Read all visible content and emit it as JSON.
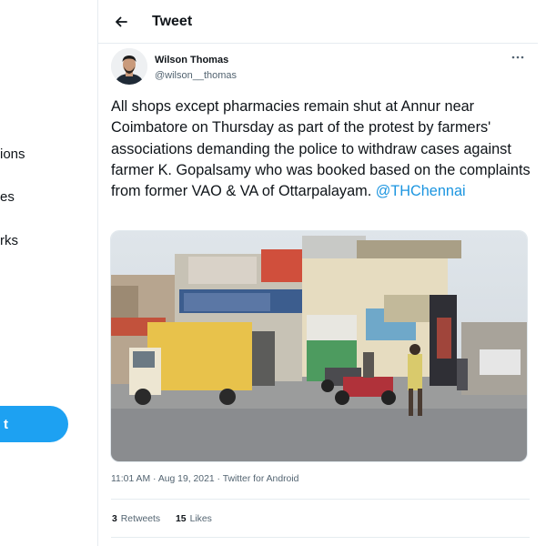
{
  "nav": {
    "items": [
      {
        "label": "ions"
      },
      {
        "label": "es"
      },
      {
        "label": "rks"
      }
    ],
    "tweet_button_label": "t"
  },
  "header": {
    "title": "Tweet",
    "back_icon": "arrow-left-icon"
  },
  "tweet": {
    "author": {
      "name": "Wilson Thomas",
      "handle": "@wilson__thomas"
    },
    "text": "All shops except pharmacies remain shut at Annur near Coimbatore on Thursday as part of the protest by farmers' associations demanding the police to withdraw cases against farmer K. Gopalsamy who was booked based on the complaints from former VAO & VA of Ottarpalayam. ",
    "mention": "@THChennai",
    "time": "11:01 AM",
    "date": "Aug 19, 2021",
    "separator": " · ",
    "source": "Twitter for Android",
    "retweets": {
      "count": "3",
      "label": "Retweets"
    },
    "likes": {
      "count": "15",
      "label": "Likes"
    }
  },
  "colors": {
    "accent": "#1da1f2",
    "link": "#1b95e0"
  }
}
